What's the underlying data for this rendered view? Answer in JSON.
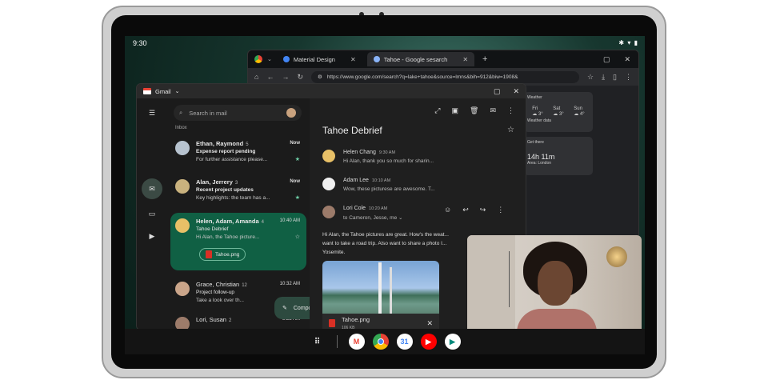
{
  "status_bar": {
    "time": "9:30",
    "icons": [
      "bluetooth-icon",
      "wifi-icon",
      "battery-icon"
    ]
  },
  "chrome": {
    "tabs": [
      {
        "label": "Material Design",
        "favicon": "#4285f4"
      },
      {
        "label": "Tahoe - Google sesarch",
        "favicon": "#8ab4f8"
      }
    ],
    "url": "https://www.google.com/search?q=lake+tahoe&source=lmns&bih=912&biw=1908&",
    "cards": [
      {
        "title": "Weather",
        "line": "Weather data"
      },
      {
        "title": "Get there",
        "big": "14h 11m",
        "line": "Area: London"
      }
    ],
    "forecast": [
      {
        "day": "Fri",
        "temp": "3°"
      },
      {
        "day": "Sat",
        "temp": "3°"
      },
      {
        "day": "Sun",
        "temp": "4°"
      }
    ]
  },
  "gmail": {
    "title": "Gmail",
    "search_placeholder": "Search in mail",
    "inbox_label": "Inbox",
    "compose_label": "Compose",
    "mails": [
      {
        "from": "Ethan, Raymond",
        "count": "5",
        "time": "Now",
        "subject": "Expense report pending",
        "snippet": "For further assistance please...",
        "avatar_color": "#b7c3cf"
      },
      {
        "from": "Alan, Jerrery",
        "count": "3",
        "time": "Now",
        "subject": "Recent project updates",
        "snippet": "Key highlights: the team has a...",
        "avatar_color": "#c9b27e"
      },
      {
        "from": "Helen, Adam, Amanda",
        "count": "4",
        "time": "10:40 AM",
        "subject": "Tahoe Debrief",
        "snippet": "Hi Alan, the Tahoe picture...",
        "avatar_color": "#e8c067",
        "attachment": "Tahoe.png"
      },
      {
        "from": "Grace, Christian",
        "count": "12",
        "time": "10:32 AM",
        "subject": "Project follow-up",
        "snippet": "Take a look over th...",
        "avatar_color": "#caa58a"
      },
      {
        "from": "Lori, Susan",
        "count": "2",
        "time": "8:22 AM",
        "subject": "",
        "snippet": "",
        "avatar_color": "#9c7b6a"
      }
    ],
    "reader": {
      "title": "Tahoe Debrief",
      "messages": [
        {
          "from": "Helen Chang",
          "time": "9:30 AM",
          "snippet": "Hi Alan, thank you so much for sharin...",
          "avatar_color": "#e8c067"
        },
        {
          "from": "Adam Lee",
          "time": "10:10 AM",
          "snippet": "Wow, these picturese are awesome. T...",
          "avatar_color": "#f0f0f0"
        },
        {
          "from": "Lori Cole",
          "time": "10:20 AM",
          "snippet": "to Cameron, Jesse, me",
          "avatar_color": "#9c7b6a"
        }
      ],
      "body": "Hi Alan, the Tahoe pictures are great. How's the weat... want to take a road trip. Also want to share a photo I... Yosemite.",
      "attachment": {
        "name": "Tahoe.png",
        "size": "106 KB"
      }
    }
  },
  "taskbar": {
    "apps": [
      "launcher-icon",
      "gmail-icon",
      "chrome-icon",
      "calendar-icon",
      "youtube-icon",
      "meet-icon"
    ]
  }
}
